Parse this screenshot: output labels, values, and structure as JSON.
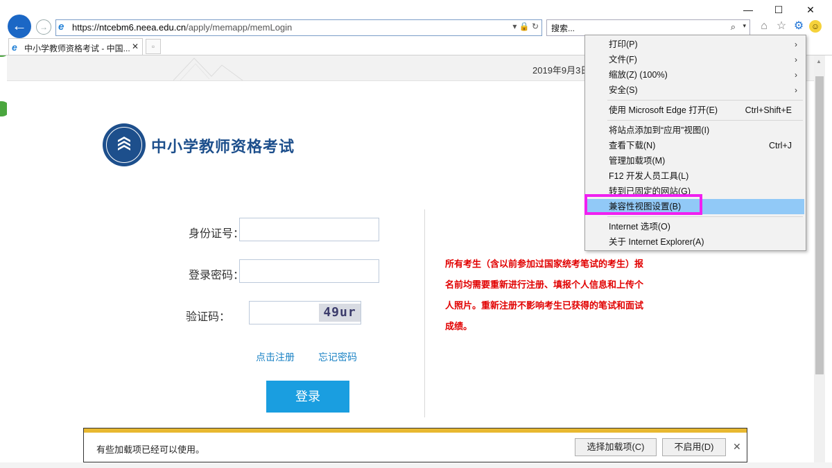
{
  "window": {
    "minimize": "—",
    "maximize": "☐",
    "close": "✕"
  },
  "nav": {
    "back": "←",
    "forward": "→"
  },
  "address": {
    "scheme": "https://",
    "host": "ntcebm6.neea.edu.cn",
    "path": "/apply/memapp/memLogin",
    "tools": "▾ 🔒 ↻"
  },
  "search": {
    "placeholder": "搜索...",
    "icon": "⌕",
    "dropdown": "▾"
  },
  "toolbar_icons": {
    "home": "⌂",
    "favorites": "☆",
    "tools": "⚙",
    "feedback": "☺"
  },
  "tab": {
    "title": "中小学教师资格考试 - 中国...",
    "close": "✕",
    "new": "▫"
  },
  "page": {
    "date": "2019年9月3日",
    "site_title": "中小学教师资格考试",
    "form": {
      "id_label": "身份证号：",
      "password_label": "登录密码：",
      "captcha_label": "验证码：",
      "captcha_text": "49ur",
      "register_link": "点击注册",
      "forgot_link": "忘记密码",
      "login_button": "登录"
    },
    "notice": "所有考生（含以前参加过国家统考笔试的考生）报名前均需要重新进行注册、填报个人信息和上传个人照片。重新注册不影响考生已获得的笔试和面试成绩。"
  },
  "notification": {
    "text": "有些加载项已经可以使用。",
    "choose_button": "选择加载项(C)",
    "disable_button": "不启用(D)",
    "close": "✕"
  },
  "menu": {
    "items": [
      {
        "label": "打印(P)",
        "shortcut": "",
        "submenu": true
      },
      {
        "label": "文件(F)",
        "shortcut": "",
        "submenu": true
      },
      {
        "label": "缩放(Z) (100%)",
        "shortcut": "",
        "submenu": true
      },
      {
        "label": "安全(S)",
        "shortcut": "",
        "submenu": true
      },
      {
        "label": "使用 Microsoft Edge 打开(E)",
        "shortcut": "Ctrl+Shift+E",
        "submenu": false
      },
      {
        "label": "将站点添加到“应用”视图(I)",
        "shortcut": "",
        "submenu": false
      },
      {
        "label": "查看下载(N)",
        "shortcut": "Ctrl+J",
        "submenu": false
      },
      {
        "label": "管理加载项(M)",
        "shortcut": "",
        "submenu": false
      },
      {
        "label": "F12 开发人员工具(L)",
        "shortcut": "",
        "submenu": false
      },
      {
        "label": "转到已固定的网站(G)",
        "shortcut": "",
        "submenu": false
      },
      {
        "label": "兼容性视图设置(B)",
        "shortcut": "",
        "submenu": false,
        "highlighted": true
      },
      {
        "label": "Internet 选项(O)",
        "shortcut": "",
        "submenu": false
      },
      {
        "label": "关于 Internet Explorer(A)",
        "shortcut": "",
        "submenu": false
      }
    ],
    "submenu_arrow": "›"
  },
  "colors": {
    "brand_blue": "#1d4f8c",
    "login_blue": "#1a9ee0",
    "notice_red": "#e10000",
    "menu_highlight": "#91c9f7",
    "annotation_magenta": "#f020f0"
  }
}
